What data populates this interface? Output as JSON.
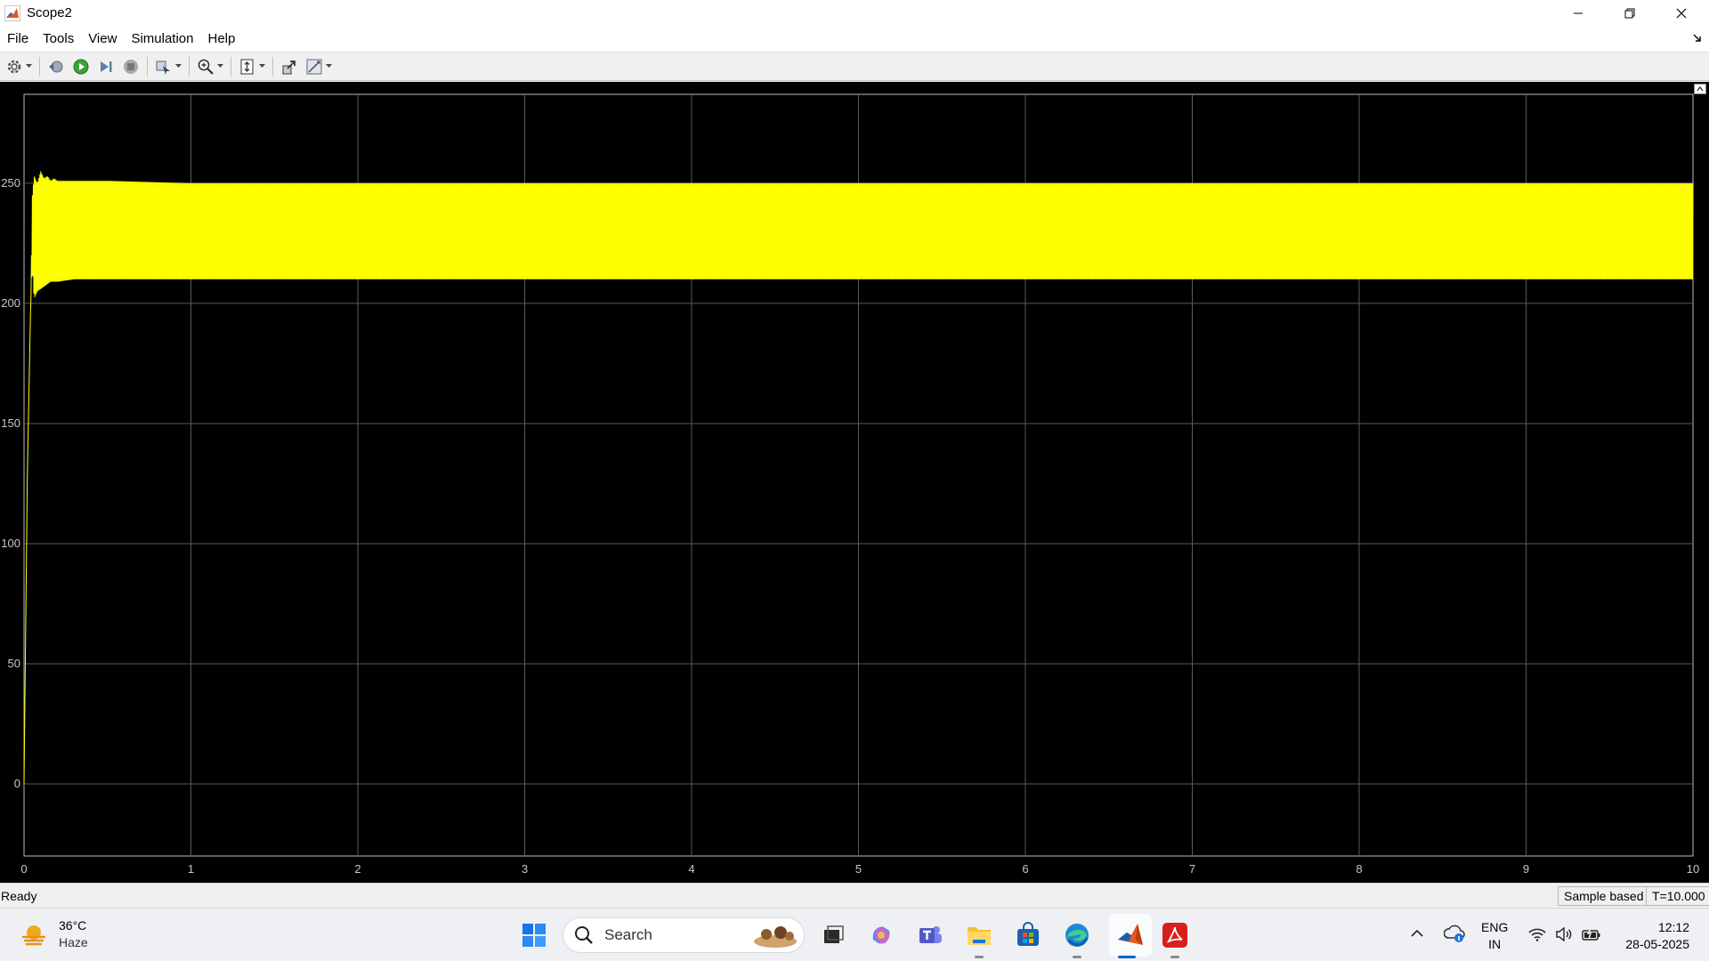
{
  "window": {
    "title": "Scope2",
    "icons": [
      "matlab-icon",
      "minimize-icon",
      "restore-icon",
      "close-icon"
    ]
  },
  "menu": {
    "items": [
      "File",
      "Tools",
      "View",
      "Simulation",
      "Help"
    ]
  },
  "toolbar": {
    "buttons": [
      "settings-icon",
      "step-back-icon",
      "run-icon",
      "step-forward-icon",
      "stop-icon",
      "highlight-icon",
      "zoom-icon",
      "scale-icon",
      "restore-layout-icon",
      "style-icon"
    ]
  },
  "colors": {
    "plot_background": "#000000",
    "trace": "#ffff00",
    "grid": "#5a5a5a",
    "axis_text": "#c8c8c8"
  },
  "chart_data": {
    "type": "line",
    "title": "",
    "xlabel": "",
    "ylabel": "",
    "xlim": [
      0,
      10
    ],
    "ylim": [
      -30,
      287
    ],
    "xticks": [
      0,
      1,
      2,
      3,
      4,
      5,
      6,
      7,
      8,
      9,
      10
    ],
    "yticks": [
      0,
      50,
      100,
      150,
      200,
      250
    ],
    "grid": true,
    "series": [
      {
        "description_color": "yellow",
        "x": [
          0,
          0.02,
          0.04,
          0.05,
          0.06,
          0.08,
          0.1,
          0.12,
          0.14,
          0.16,
          0.18,
          0.2,
          0.3,
          0.5,
          1,
          2,
          3,
          4,
          5,
          6,
          7,
          8,
          9,
          10
        ],
        "upper": [
          0,
          130,
          200,
          245,
          253,
          250,
          255,
          252,
          253,
          251,
          252,
          251,
          251,
          251,
          250,
          250,
          250,
          250,
          250,
          250,
          250,
          250,
          250,
          250
        ],
        "lower": [
          0,
          130,
          200,
          215,
          202,
          205,
          206,
          207,
          208,
          209,
          209,
          209,
          210,
          210,
          210,
          210,
          210,
          210,
          210,
          210,
          210,
          210,
          210,
          210
        ]
      }
    ]
  },
  "status": {
    "text": "Ready",
    "mode": "Sample based",
    "time": "T=10.000"
  },
  "taskbar": {
    "weather_temp": "36°C",
    "weather_desc": "Haze",
    "search_placeholder": "Search",
    "apps": [
      "windows-start-icon",
      "search-icon",
      "task-view-icon",
      "copilot-icon",
      "teams-icon",
      "file-explorer-icon",
      "store-icon",
      "edge-icon",
      "matlab-taskbar-icon",
      "acrobat-icon"
    ],
    "lang_line1": "ENG",
    "lang_line2": "IN",
    "time": "12:12",
    "date": "28-05-2025"
  }
}
